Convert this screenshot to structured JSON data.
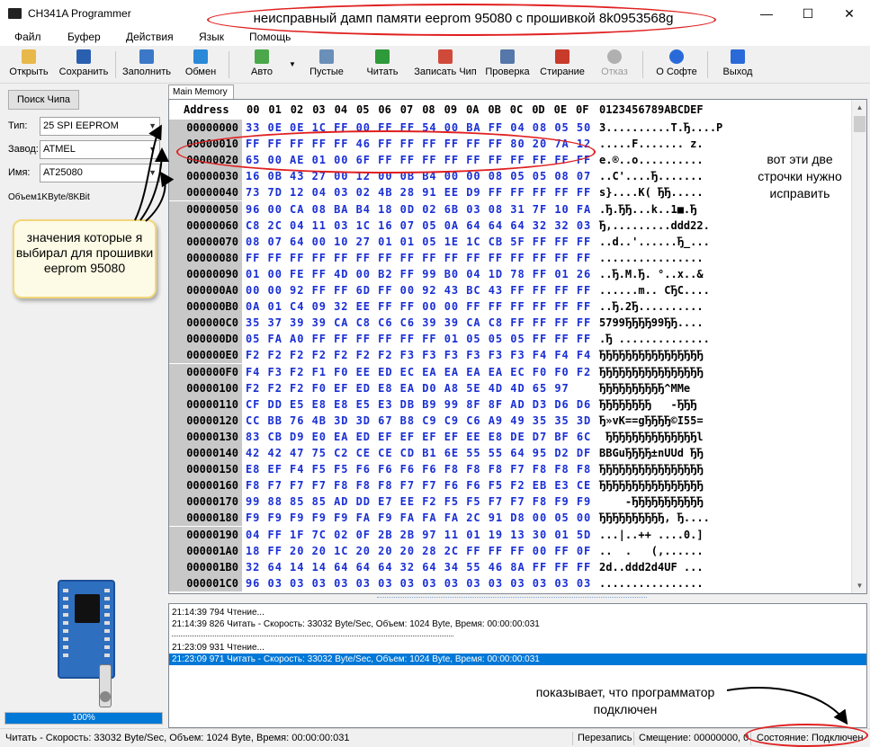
{
  "window": {
    "title": "CH341A Programmer",
    "minimize": "—",
    "maximize": "☐",
    "close": "✕"
  },
  "menu": [
    "Файл",
    "Буфер",
    "Действия",
    "Язык",
    "Помощь"
  ],
  "toolbar": [
    {
      "label": "Открыть",
      "icon": "folder-open-icon",
      "color": "#e8b84a"
    },
    {
      "label": "Сохранить",
      "icon": "floppy-disk-icon",
      "color": "#2a5fb0"
    },
    {
      "label": "Заполнить",
      "icon": "fill-icon",
      "color": "#3b78c8"
    },
    {
      "label": "Обмен",
      "icon": "swap-arrows-icon",
      "color": "#2a8ad8"
    },
    {
      "label": "Авто",
      "icon": "auto-chip-icon",
      "color": "#4aa84a"
    },
    {
      "label": "Пустые",
      "icon": "blank-check-icon",
      "color": "#6a8fb8"
    },
    {
      "label": "Читать",
      "icon": "read-chip-icon",
      "color": "#2e9a3a"
    },
    {
      "label": "Записать Чип",
      "icon": "write-chip-icon",
      "color": "#d04a3a"
    },
    {
      "label": "Проверка",
      "icon": "verify-icon",
      "color": "#5577aa"
    },
    {
      "label": "Стирание",
      "icon": "erase-icon",
      "color": "#c83a2a"
    },
    {
      "label": "Отказ",
      "icon": "cancel-icon",
      "color": "#b0b0b0"
    },
    {
      "label": "О Софте",
      "icon": "about-icon",
      "color": "#2a6ad8"
    },
    {
      "label": "Выход",
      "icon": "exit-icon",
      "color": "#2a6ad8"
    }
  ],
  "left": {
    "search_chip": "Поиск Чипа",
    "type_label": "Тип:",
    "type_value": "25 SPI EEPROM",
    "vendor_label": "Завод:",
    "vendor_value": "ATMEL",
    "name_label": "Имя:",
    "name_value": "AT25080",
    "volume": "Объем1KByte/8KBit",
    "progress_text": "100%",
    "progress": 1.0
  },
  "hex": {
    "tab": "Main Memory",
    "address_header": "Address",
    "columns": [
      "00",
      "01",
      "02",
      "03",
      "04",
      "05",
      "06",
      "07",
      "08",
      "09",
      "0A",
      "0B",
      "0C",
      "0D",
      "0E",
      "0F"
    ],
    "ascii_header": "0123456789ABCDEF",
    "rows": [
      {
        "a": "00000000",
        "b": "33 0E 0E 1C FF 00 FF FF 54 00 BA FF 04 08 05 50",
        "t": "3..........T.Ђ....P"
      },
      {
        "a": "00000010",
        "b": "FF FF FF FF FF 46 FF FF FF FF FF FF 80 20 7A 12",
        "t": ".....F....... z."
      },
      {
        "a": "00000020",
        "b": "65 00 AE 01 00 6F FF FF FF FF FF FF FF FF FF FF",
        "t": "e.®..o.........."
      },
      {
        "a": "00000030",
        "b": "16 0B 43 27 00 12 00 0B B4 00 00 08 05 05 08 07",
        "t": "..C'....Ђ......."
      },
      {
        "a": "00000040",
        "b": "73 7D 12 04 03 02 4B 28 91 EE D9 FF FF FF FF FF",
        "t": "s}....K( ЂЂ....."
      },
      {
        "a": "00000050",
        "b": "96 00 CA 08 BA B4 18 0D 02 6B 03 08 31 7F 10 FA",
        "t": ".Ђ.ЂЂ...k..1■.Ђ"
      },
      {
        "a": "00000060",
        "b": "C8 2C 04 11 03 1C 16 07 05 0A 64 64 64 32 32 03",
        "t": "Ђ,.........ddd22."
      },
      {
        "a": "00000070",
        "b": "08 07 64 00 10 27 01 01 05 1E 1C CB 5F FF FF FF",
        "t": "..d..'......Ђ_..."
      },
      {
        "a": "00000080",
        "b": "FF FF FF FF FF FF FF FF FF FF FF FF FF FF FF FF",
        "t": "................"
      },
      {
        "a": "00000090",
        "b": "01 00 FE FF 4D 00 B2 FF 99 B0 04 1D 78 FF 01 26",
        "t": "..Ђ.M.Ђ. °..x..&"
      },
      {
        "a": "000000A0",
        "b": "00 00 92 FF FF 6D FF 00 92 43 BC 43 FF FF FF FF",
        "t": "......m.. CЂC...."
      },
      {
        "a": "000000B0",
        "b": "0A 01 C4 09 32 EE FF FF 00 00 FF FF FF FF FF FF",
        "t": "..Ђ.2Ђ.........."
      },
      {
        "a": "000000C0",
        "b": "35 37 39 39 CA C8 C6 C6 39 39 CA C8 FF FF FF FF",
        "t": "5799ЂЂЂЂ99ЂЂ...."
      },
      {
        "a": "000000D0",
        "b": "05 FA A0 FF FF FF FF FF FF 01 05 05 05 FF FF FF",
        "t": ".Ђ .............."
      },
      {
        "a": "000000E0",
        "b": "F2 F2 F2 F2 F2 F2 F2 F3 F3 F3 F3 F3 F3 F4 F4 F4",
        "t": "ЂЂЂЂЂЂЂЂЂЂЂЂЂЂЂЂ"
      },
      {
        "a": "000000F0",
        "b": "F4 F3 F2 F1 F0 EE ED EC EA EA EA EA EC F0 F0 F2",
        "t": "ЂЂЂЂЂЂЂЂЂЂЂЂЂЂЂЂ"
      },
      {
        "a": "00000100",
        "b": "F2 F2 F2 F0 EF ED E8 EA D0 A8 5E 4D 4D 65 97",
        "t": "ЂЂЂЂЂЂЂЂЂЂ^MMe"
      },
      {
        "a": "00000110",
        "b": "CF DD E5 E8 E8 E5 E3 DB B9 99 8F 8F AD D3 D6 D6",
        "t": "ЂЂЂЂЂЂЂЂ   -ЂЂЂ"
      },
      {
        "a": "00000120",
        "b": "CC BB 76 4B 3D 3D 67 B8 C9 C9 C6 A9 49 35 35 3D",
        "t": "Ђ»vK==gЂЂЂЂ©I55="
      },
      {
        "a": "00000130",
        "b": "83 CB D9 E0 EA ED EF EF EF EF EE E8 DE D7 BF 6C",
        "t": " ЂЂЂЂЂЂЂЂЂЂЂЂЂЂl"
      },
      {
        "a": "00000140",
        "b": "42 42 47 75 C2 CE CE CD B1 6E 55 55 64 95 D2 DF",
        "t": "BBGuЂЂЂЂ±nUUd ЂЂ"
      },
      {
        "a": "00000150",
        "b": "E8 EF F4 F5 F5 F6 F6 F6 F6 F8 F8 F8 F7 F8 F8 F8",
        "t": "ЂЂЂЂЂЂЂЂЂЂЂЂЂЂЂЂ"
      },
      {
        "a": "00000160",
        "b": "F8 F7 F7 F7 F8 F8 F8 F7 F7 F6 F6 F5 F2 EB E3 CE",
        "t": "ЂЂЂЂЂЂЂЂЂЂЂЂЂЂЂЂ"
      },
      {
        "a": "00000170",
        "b": "99 88 85 85 AD DD E7 EE F2 F5 F5 F7 F7 F8 F9 F9",
        "t": "    -ЂЂЂЂЂЂЂЂЂЂЂ"
      },
      {
        "a": "00000180",
        "b": "F9 F9 F9 F9 F9 FA F9 FA FA FA 2C 91 D8 00 05 00",
        "t": "ЂЂЂЂЂЂЂЂЂЂ, Ђ...."
      },
      {
        "a": "00000190",
        "b": "04 FF 1F 7C 02 0F 2B 2B 97 11 01 19 13 30 01 5D",
        "t": "...|..++ ....0.]"
      },
      {
        "a": "000001A0",
        "b": "18 FF 20 20 1C 20 20 20 28 2C FF FF FF 00 FF 0F",
        "t": "..  .   (,......"
      },
      {
        "a": "000001B0",
        "b": "32 64 14 14 64 64 64 32 64 34 55 46 8A FF FF FF",
        "t": "2d..ddd2d4UF ..."
      },
      {
        "a": "000001C0",
        "b": "96 03 03 03 03 03 03 03 03 03 03 03 03 03 03 03",
        "t": "................"
      }
    ]
  },
  "log": {
    "lines": [
      "21:14:39 794 Чтение...",
      "21:14:39 826 Читать - Скорость: 33032 Byte/Sec, Объем: 1024 Byte, Время: 00:00:00:031",
      "",
      "21:23:09 931 Чтение...",
      "21:23:09 971 Читать - Скорость: 33032 Byte/Sec, Объем: 1024 Byte, Время: 00:00:00:031"
    ]
  },
  "status": {
    "read": "Читать - Скорость: 33032 Byte/Sec, Объем: 1024 Byte, Время: 00:00:00:031",
    "mode": "Перезапись",
    "offset": "Смещение: 00000000, 0",
    "state": "Состояние: Подключен"
  },
  "annotations": {
    "title": "неисправный дамп памяти eeprom 95080 с прошивкой 8k0953568g",
    "rows_note": "вот эти две строчки нужно исправить",
    "chose_note": "значения которые я выбирал для прошивки eeprom 95080",
    "connected_note": "показывает, что программатор подключен"
  },
  "colors": {
    "accent": "#0078d7",
    "hex_bytes": "#1a2fd4",
    "annotation": "#e02020"
  }
}
